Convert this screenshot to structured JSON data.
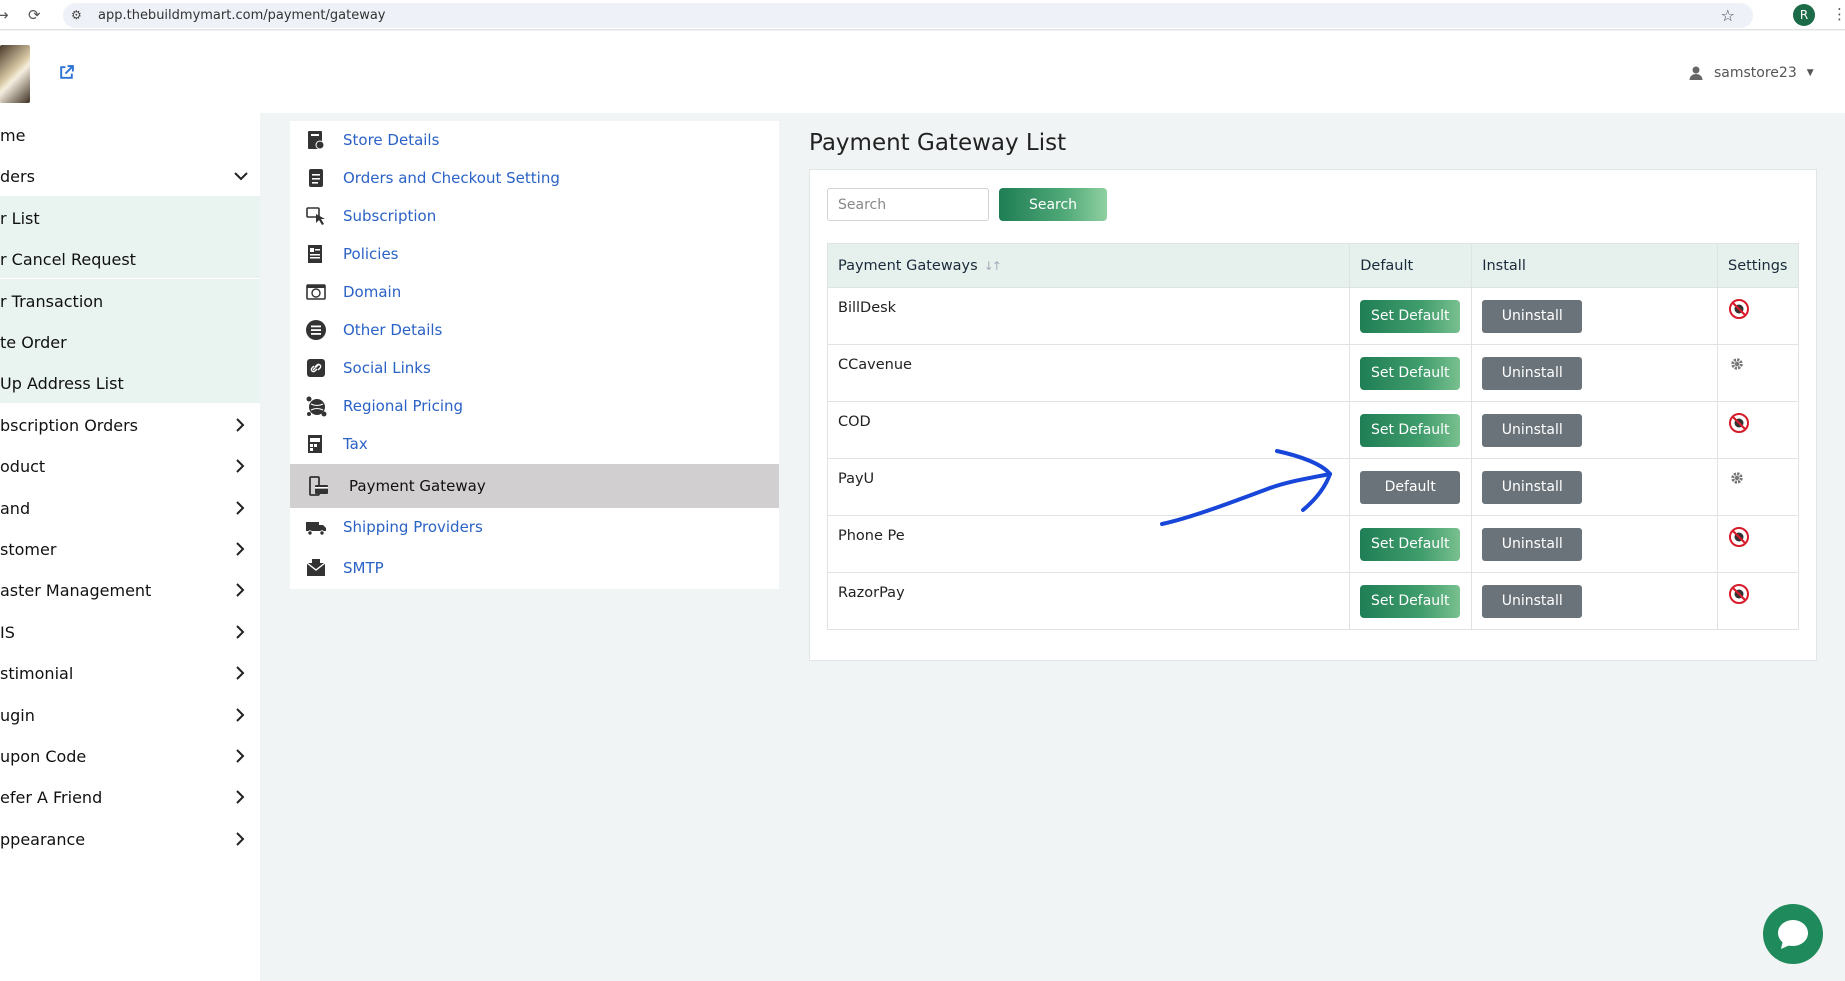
{
  "browser": {
    "url": "app.thebuildmymart.com/payment/gateway",
    "profile_initial": "R"
  },
  "header": {
    "username": "samstore23"
  },
  "sidebar": {
    "items": [
      {
        "label": "me",
        "chevron": "none"
      },
      {
        "label": "ders",
        "chevron": "down"
      },
      {
        "label": "r List",
        "chevron": "none",
        "sub": true
      },
      {
        "label": "r Cancel Request",
        "chevron": "none",
        "sub": true
      },
      {
        "label": "r Transaction",
        "chevron": "none",
        "sub": true
      },
      {
        "label": "te Order",
        "chevron": "none",
        "sub": true
      },
      {
        "label": "Up Address List",
        "chevron": "none",
        "sub": true
      },
      {
        "label": "bscription Orders",
        "chevron": "right"
      },
      {
        "label": "oduct",
        "chevron": "right"
      },
      {
        "label": "and",
        "chevron": "right"
      },
      {
        "label": "stomer",
        "chevron": "right"
      },
      {
        "label": "aster Management",
        "chevron": "right"
      },
      {
        "label": "IS",
        "chevron": "right"
      },
      {
        "label": "stimonial",
        "chevron": "right"
      },
      {
        "label": "ugin",
        "chevron": "right"
      },
      {
        "label": "upon Code",
        "chevron": "right"
      },
      {
        "label": "efer A Friend",
        "chevron": "right"
      },
      {
        "label": "ppearance",
        "chevron": "right"
      }
    ]
  },
  "settings_menu": {
    "items": [
      {
        "label": "Store Details",
        "icon": "store-details-icon"
      },
      {
        "label": "Orders and Checkout Setting",
        "icon": "document-icon"
      },
      {
        "label": "Subscription",
        "icon": "subscription-icon"
      },
      {
        "label": "Policies",
        "icon": "policies-icon"
      },
      {
        "label": "Domain",
        "icon": "domain-icon"
      },
      {
        "label": "Other Details",
        "icon": "list-icon"
      },
      {
        "label": "Social Links",
        "icon": "link-icon"
      },
      {
        "label": "Regional Pricing",
        "icon": "globe-icon"
      },
      {
        "label": "Tax",
        "icon": "tax-icon"
      },
      {
        "label": "Payment Gateway",
        "icon": "payment-icon",
        "active": true
      },
      {
        "label": "Shipping Providers",
        "icon": "truck-icon"
      },
      {
        "label": "SMTP",
        "icon": "mail-icon"
      }
    ]
  },
  "main": {
    "title": "Payment Gateway List",
    "search": {
      "placeholder": "Search",
      "button": "Search"
    },
    "table": {
      "headers": [
        "Payment Gateways",
        "Default",
        "Install",
        "Settings"
      ],
      "rows": [
        {
          "name": "BillDesk",
          "default_button": "Set Default",
          "is_default": false,
          "install_button": "Uninstall",
          "settings_icon": "disabled-icon"
        },
        {
          "name": "CCavenue",
          "default_button": "Set Default",
          "is_default": false,
          "install_button": "Uninstall",
          "settings_icon": "gear-icon"
        },
        {
          "name": "COD",
          "default_button": "Set Default",
          "is_default": false,
          "install_button": "Uninstall",
          "settings_icon": "disabled-icon"
        },
        {
          "name": "PayU",
          "default_button": "Default",
          "is_default": true,
          "install_button": "Uninstall",
          "settings_icon": "gear-icon"
        },
        {
          "name": "Phone Pe",
          "default_button": "Set Default",
          "is_default": false,
          "install_button": "Uninstall",
          "settings_icon": "disabled-icon"
        },
        {
          "name": "RazorPay",
          "default_button": "Set Default",
          "is_default": false,
          "install_button": "Uninstall",
          "settings_icon": "disabled-icon"
        }
      ]
    }
  },
  "colors": {
    "accent_green": "#1f7e55",
    "link_blue": "#2b62c6",
    "annotation_blue": "#1746d8",
    "disabled_red": "#d81b2a"
  }
}
